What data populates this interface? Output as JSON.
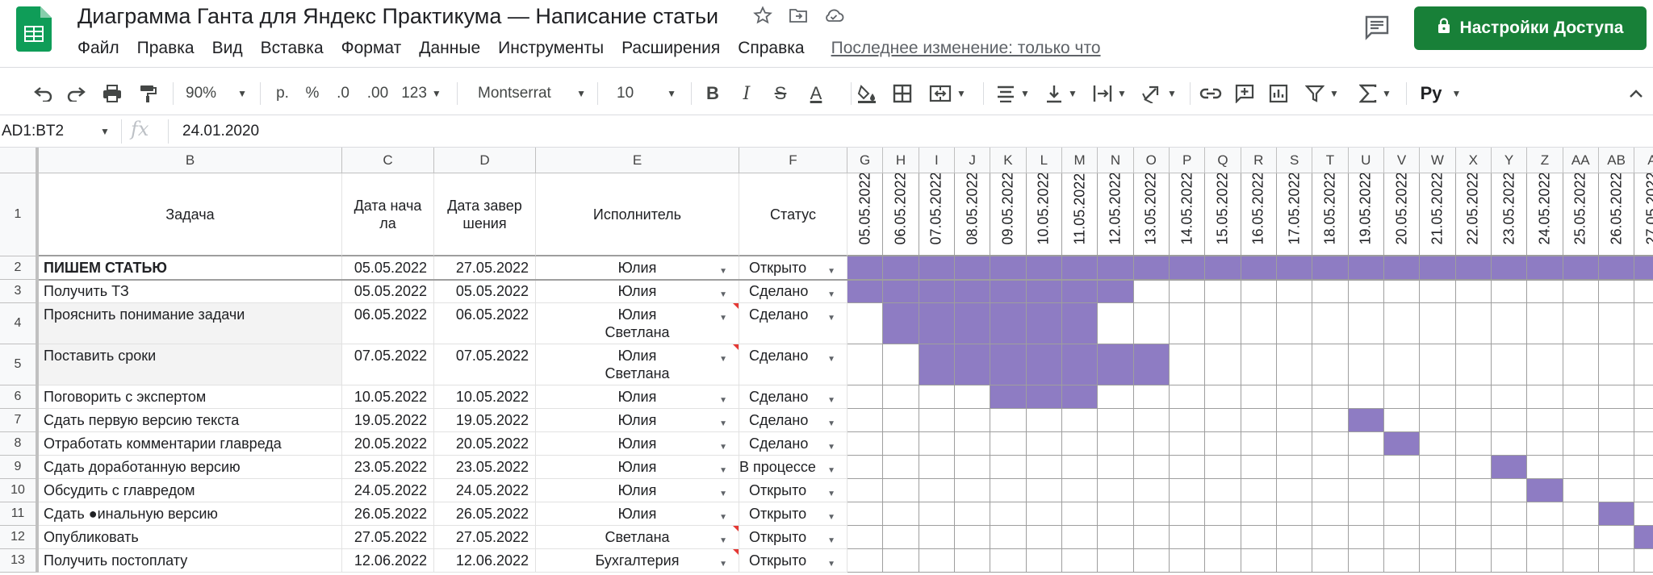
{
  "doc": {
    "title": "Диаграмма Ганта для Яндекс Практикума — Написание статьи",
    "last_edit": "Последнее изменение: только что"
  },
  "menu": [
    "Файл",
    "Правка",
    "Вид",
    "Вставка",
    "Формат",
    "Данные",
    "Инструменты",
    "Расширения",
    "Справка"
  ],
  "share": {
    "label": "Настройки Доступа",
    "color": "#188038"
  },
  "toolbar": {
    "zoom": "90%",
    "currency": "р.",
    "percent": "%",
    "dec_less": ".0",
    "dec_more": ".00",
    "more_formats": "123",
    "font": "Montserrat",
    "font_size": "10",
    "bold": "B",
    "italic": "I",
    "strike": "S",
    "text_color": "A",
    "input_tool": "Ру"
  },
  "formula_bar": {
    "name_box": "AD1:BT2",
    "fx": "fx",
    "value": "24.01.2020"
  },
  "columns": [
    "B",
    "C",
    "D",
    "E",
    "F",
    "G",
    "H",
    "I",
    "J",
    "K",
    "L",
    "M",
    "N",
    "O",
    "P",
    "Q",
    "R",
    "S",
    "T",
    "U",
    "V",
    "W",
    "X",
    "Y",
    "Z",
    "AA",
    "AB",
    "A"
  ],
  "row_numbers": [
    "1",
    "2",
    "3",
    "4",
    "5",
    "6",
    "7",
    "8",
    "9",
    "10",
    "11",
    "12",
    "13"
  ],
  "headers": {
    "task": "Задача",
    "start": "Дата начала",
    "end": "Дата завершения",
    "executor": "Исполнитель",
    "status": "Статус"
  },
  "dates": [
    "05.05.2022",
    "06.05.2022",
    "07.05.2022",
    "08.05.2022",
    "09.05.2022",
    "10.05.2022",
    "11.05.2022",
    "12.05.2022",
    "13.05.2022",
    "14.05.2022",
    "15.05.2022",
    "16.05.2022",
    "17.05.2022",
    "18.05.2022",
    "19.05.2022",
    "20.05.2022",
    "21.05.2022",
    "22.05.2022",
    "23.05.2022",
    "24.05.2022",
    "25.05.2022",
    "26.05.2022",
    "27.05.2022"
  ],
  "gantt_color": "#8e7cc3",
  "tasks": [
    {
      "task": "ПИШЕМ СТАТЬЮ",
      "start": "05.05.2022",
      "end": "27.05.2022",
      "executor": "Юлия",
      "status": "Открыто",
      "bold": true,
      "note": false,
      "fill": [
        0,
        22
      ]
    },
    {
      "task": "Получить ТЗ",
      "start": "05.05.2022",
      "end": "05.05.2022",
      "executor": "Юлия",
      "status": "Сделано",
      "note": false,
      "fill": [
        0,
        7
      ]
    },
    {
      "task": "Прояснить понимание задачи",
      "start": "06.05.2022",
      "end": "06.05.2022",
      "executor": "Юлия\nСветлана",
      "status": "Сделано",
      "note": true,
      "fill": [
        1,
        6
      ]
    },
    {
      "task": "Поставить сроки",
      "start": "07.05.2022",
      "end": "07.05.2022",
      "executor": "Юлия\nСветлана",
      "status": "Сделано",
      "note": true,
      "fill": [
        2,
        8
      ]
    },
    {
      "task": "Поговорить с экспертом",
      "start": "10.05.2022",
      "end": "10.05.2022",
      "executor": "Юлия",
      "status": "Сделано",
      "note": false,
      "fill": [
        4,
        6
      ]
    },
    {
      "task": "Сдать первую версию текста",
      "start": "19.05.2022",
      "end": "19.05.2022",
      "executor": "Юлия",
      "status": "Сделано",
      "note": false,
      "fill": [
        14,
        14
      ]
    },
    {
      "task": "Отработать комментарии главреда",
      "start": "20.05.2022",
      "end": "20.05.2022",
      "executor": "Юлия",
      "status": "Сделано",
      "note": false,
      "fill": [
        15,
        15
      ]
    },
    {
      "task": "Сдать доработанную версию",
      "start": "23.05.2022",
      "end": "23.05.2022",
      "executor": "Юлия",
      "status": "В процессе",
      "note": false,
      "fill": [
        18,
        18
      ]
    },
    {
      "task": "Обсудить с главредом",
      "start": "24.05.2022",
      "end": "24.05.2022",
      "executor": "Юлия",
      "status": "Открыто",
      "note": false,
      "fill": [
        19,
        19
      ]
    },
    {
      "task": "Сдать ●инальную версию",
      "start": "26.05.2022",
      "end": "26.05.2022",
      "executor": "Юлия",
      "status": "Открыто",
      "note": false,
      "fill": [
        21,
        21
      ]
    },
    {
      "task": "Опубликовать",
      "start": "27.05.2022",
      "end": "27.05.2022",
      "executor": "Светлана",
      "status": "Открыто",
      "note": true,
      "fill": [
        22,
        22
      ]
    },
    {
      "task": "Получить постоплату",
      "start": "12.06.2022",
      "end": "12.06.2022",
      "executor": "Бухгалтерия",
      "status": "Открыто",
      "note": true,
      "fill": null
    }
  ]
}
